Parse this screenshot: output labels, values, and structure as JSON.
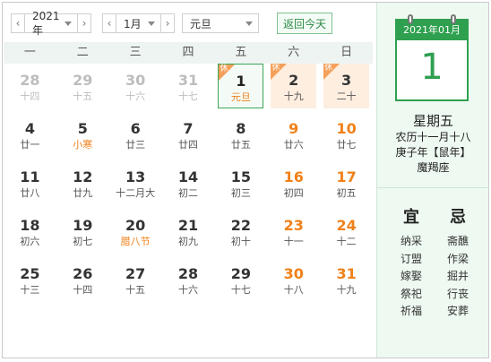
{
  "toolbar": {
    "prev_year": "‹",
    "year": "2021年",
    "next_year": "›",
    "prev_month": "‹",
    "month": "1月",
    "next_month": "›",
    "holiday": "元旦",
    "today_button": "返回今天"
  },
  "weekdays": [
    "一",
    "二",
    "三",
    "四",
    "五",
    "六",
    "日"
  ],
  "days": [
    {
      "d": "28",
      "l": "十四",
      "type": "other"
    },
    {
      "d": "29",
      "l": "十五",
      "type": "other"
    },
    {
      "d": "30",
      "l": "十六",
      "type": "other"
    },
    {
      "d": "31",
      "l": "十七",
      "type": "other"
    },
    {
      "d": "1",
      "l": "元旦",
      "type": "today",
      "rest": "休"
    },
    {
      "d": "2",
      "l": "十九",
      "type": "holiday",
      "rest": "休"
    },
    {
      "d": "3",
      "l": "二十",
      "type": "holiday",
      "rest": "休"
    },
    {
      "d": "4",
      "l": "廿一"
    },
    {
      "d": "5",
      "l": "小寒",
      "fest": true
    },
    {
      "d": "6",
      "l": "廿三"
    },
    {
      "d": "7",
      "l": "廿四"
    },
    {
      "d": "8",
      "l": "廿五"
    },
    {
      "d": "9",
      "l": "廿六",
      "type": "weekend"
    },
    {
      "d": "10",
      "l": "廿七",
      "type": "weekend"
    },
    {
      "d": "11",
      "l": "廿八"
    },
    {
      "d": "12",
      "l": "廿九"
    },
    {
      "d": "13",
      "l": "十二月大"
    },
    {
      "d": "14",
      "l": "初二"
    },
    {
      "d": "15",
      "l": "初三"
    },
    {
      "d": "16",
      "l": "初四",
      "type": "weekend"
    },
    {
      "d": "17",
      "l": "初五",
      "type": "weekend"
    },
    {
      "d": "18",
      "l": "初六"
    },
    {
      "d": "19",
      "l": "初七"
    },
    {
      "d": "20",
      "l": "腊八节",
      "fest": true
    },
    {
      "d": "21",
      "l": "初九"
    },
    {
      "d": "22",
      "l": "初十"
    },
    {
      "d": "23",
      "l": "十一",
      "type": "weekend"
    },
    {
      "d": "24",
      "l": "十二",
      "type": "weekend"
    },
    {
      "d": "25",
      "l": "十三"
    },
    {
      "d": "26",
      "l": "十四"
    },
    {
      "d": "27",
      "l": "十五"
    },
    {
      "d": "28",
      "l": "十六"
    },
    {
      "d": "29",
      "l": "十七"
    },
    {
      "d": "30",
      "l": "十八",
      "type": "weekend"
    },
    {
      "d": "31",
      "l": "十九",
      "type": "weekend"
    }
  ],
  "side": {
    "header": "2021年01月",
    "day": "1",
    "weekday": "星期五",
    "lunar": "农历十一月十八",
    "ganzhi": "庚子年【鼠年】",
    "zodiac": "魔羯座",
    "yi_title": "宜",
    "ji_title": "忌",
    "yi": [
      "纳采",
      "订盟",
      "嫁娶",
      "祭祀",
      "祈福"
    ],
    "ji": [
      "斋醮",
      "作梁",
      "掘井",
      "行丧",
      "安葬"
    ]
  },
  "colors": {
    "accent_green": "#2fa04f",
    "weekend_orange": "#f0811a",
    "holiday_bg": "#fdeee0",
    "side_bg": "#eef9f1"
  }
}
